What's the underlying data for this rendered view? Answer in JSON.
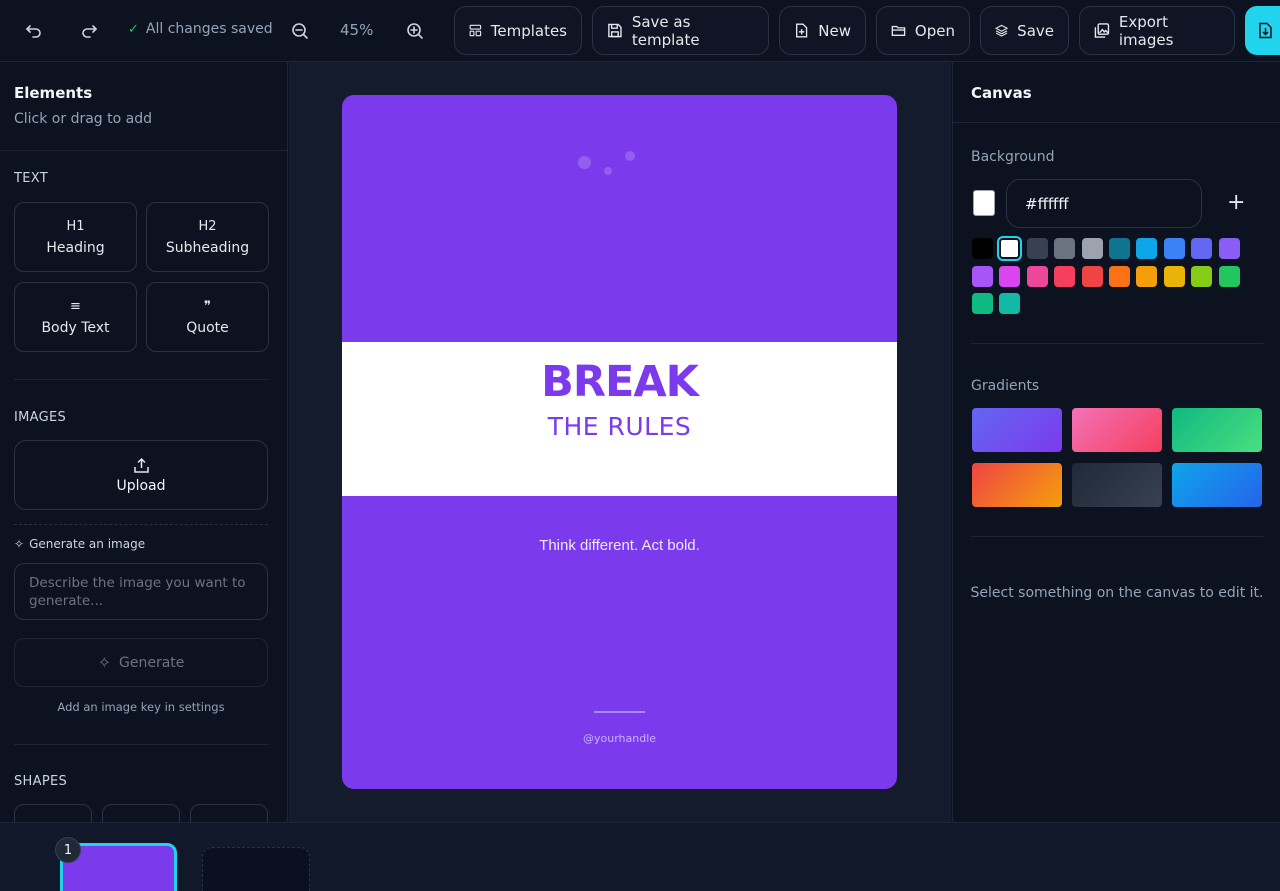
{
  "toolbar": {
    "saved_status": "All changes saved",
    "zoom": "45%",
    "templates": "Templates",
    "save_as_template": "Save as template",
    "new": "New",
    "open": "Open",
    "save": "Save",
    "export": "Export images"
  },
  "elements_panel": {
    "title": "Elements",
    "subtitle": "Click or drag to add",
    "text_section": "TEXT",
    "text_items": [
      {
        "glyph": "H1",
        "label": "Heading"
      },
      {
        "glyph": "H2",
        "label": "Subheading"
      },
      {
        "glyph": "≡",
        "label": "Body Text"
      },
      {
        "glyph": "❞",
        "label": "Quote"
      }
    ],
    "images_section": "IMAGES",
    "upload": "Upload",
    "generate_label": "Generate an image",
    "generate_placeholder": "Describe the image you want to generate...",
    "generate_button": "Generate",
    "generate_hint": "Add an image key in settings",
    "shapes_section": "SHAPES"
  },
  "canvas_card": {
    "headline": "BREAK",
    "subheadline": "THE RULES",
    "tagline": "Think different. Act bold.",
    "handle": "@yourhandle",
    "background": "#7c3aed",
    "band_color": "#ffffff"
  },
  "canvas_panel": {
    "title": "Canvas",
    "background_label": "Background",
    "hex_value": "#ffffff",
    "swatches": [
      "#000000",
      "#ffffff",
      "#374151",
      "#6b7280",
      "#9ca3af",
      "#0e7490",
      "#0ea5e9",
      "#3b82f6",
      "#6366f1",
      "#8b5cf6",
      "#a855f7",
      "#d946ef",
      "#ec4899",
      "#f43f5e",
      "#ef4444",
      "#f97316",
      "#f59e0b",
      "#eab308",
      "#84cc16",
      "#22c55e",
      "#10b981",
      "#14b8a6"
    ],
    "selected_swatch": "#ffffff",
    "gradients_label": "Gradients",
    "gradients": [
      [
        "#6366f1",
        "#7c3aed"
      ],
      [
        "#f472b6",
        "#f43f5e"
      ],
      [
        "#10b981",
        "#4ade80"
      ],
      [
        "#ef4444",
        "#f59e0b"
      ],
      [
        "#1f2937",
        "#374151"
      ],
      [
        "#0ea5e9",
        "#2563eb"
      ]
    ],
    "hint": "Select something on the canvas to edit it."
  },
  "pages": {
    "current_number": "1"
  }
}
